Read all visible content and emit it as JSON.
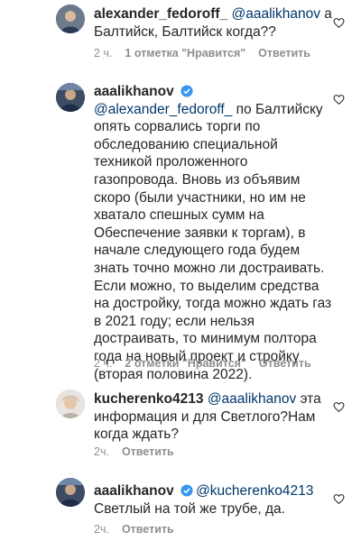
{
  "comments": [
    {
      "username": "alexander_fedoroff_",
      "verified": false,
      "mention": "@aaalikhanov",
      "body": " а Балтийск, Балтийск когда??",
      "time": "2 ч.",
      "likes": "1 отметка \"Нравится\"",
      "reply": "Ответить",
      "like_icon": "heart-outline-icon"
    },
    {
      "username": "aaalikhanov",
      "verified": true,
      "mention": "@alexander_fedoroff_",
      "body": " по Балтийску опять сорвались торги по обследованию специальной техникой проложенного газопровода. Вновь из объявим скоро (были участники, но им не хватало спешных сумм на Обеспечение заявки к торгам), в начале следующего года будем знать точно можно ли достраивать. Если можно, то выделим средства на достройку, тогда можно ждать газ в 2021 году; если нельзя достраивать, то минимум полтора года  на новый проект и стройку (вторая половина 2022).",
      "time": "2 ч.",
      "likes": "2 отметки \"Нравится\"",
      "reply": "Ответить",
      "like_icon": "heart-outline-icon"
    },
    {
      "username": "kucherenko4213",
      "verified": false,
      "mention": "@aaalikhanov",
      "body": " эта информация и для Светлого?Нам когда ждать?",
      "time": "2ч.",
      "reply": "Ответить",
      "like_icon": "heart-outline-icon"
    },
    {
      "username": "aaalikhanov",
      "verified": true,
      "mention": "@kucherenko4213",
      "body": "Светлый на той же трубе, да.",
      "time": "2ч.",
      "reply": "Ответить",
      "like_icon": "heart-outline-icon"
    }
  ],
  "colors": {
    "text": "#262626",
    "mention": "#00376b",
    "meta": "#8e8e8e",
    "verified": "#3897f0"
  }
}
